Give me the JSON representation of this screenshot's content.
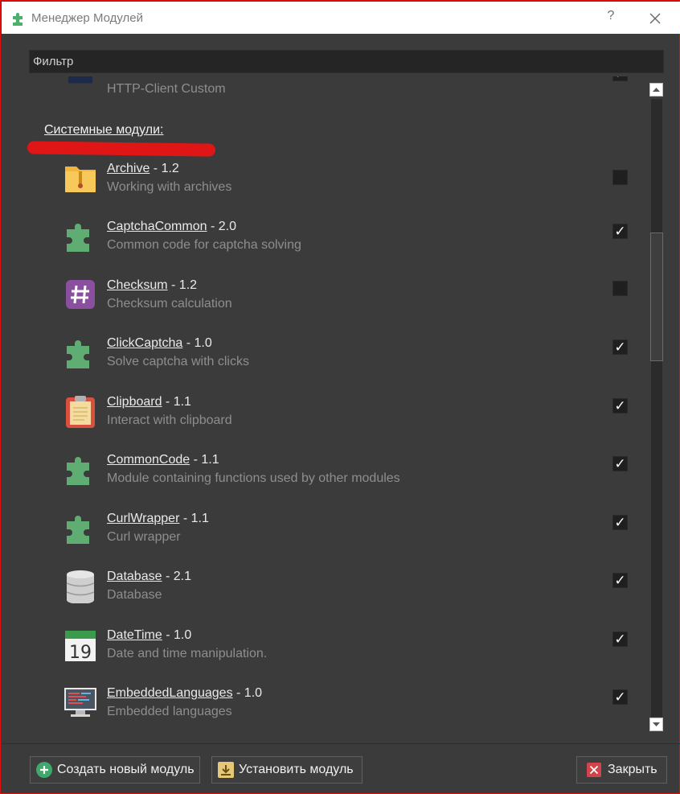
{
  "window": {
    "title": "Менеджер Модулей",
    "help_glyph": "?",
    "accent_border": "#e01010"
  },
  "filter": {
    "placeholder": "Фильтр"
  },
  "partial_item": {
    "description": "HTTP-Client Custom",
    "checked": true
  },
  "section": {
    "title": "Системные модули:"
  },
  "modules": [
    {
      "name": "Archive",
      "version": "1.2",
      "description": "Working with archives",
      "checked": false,
      "icon": "zip-folder-icon"
    },
    {
      "name": "CaptchaCommon",
      "version": "2.0",
      "description": "Common code for captcha solving",
      "checked": true,
      "icon": "puzzle-icon"
    },
    {
      "name": "Checksum",
      "version": "1.2",
      "description": "Checksum calculation",
      "checked": false,
      "icon": "hash-icon"
    },
    {
      "name": "ClickCaptcha",
      "version": "1.0",
      "description": "Solve captcha with clicks",
      "checked": true,
      "icon": "puzzle-icon"
    },
    {
      "name": "Clipboard",
      "version": "1.1",
      "description": "Interact with clipboard",
      "checked": true,
      "icon": "clipboard-icon"
    },
    {
      "name": "CommonCode",
      "version": "1.1",
      "description": "Module containing functions used by other modules",
      "checked": true,
      "icon": "puzzle-icon"
    },
    {
      "name": "CurlWrapper",
      "version": "1.1",
      "description": "Curl wrapper",
      "checked": true,
      "icon": "puzzle-icon"
    },
    {
      "name": "Database",
      "version": "2.1",
      "description": "Database",
      "checked": true,
      "icon": "database-icon"
    },
    {
      "name": "DateTime",
      "version": "1.0",
      "description": "Date and time manipulation.",
      "checked": true,
      "icon": "calendar-icon",
      "calendar_day": "19"
    },
    {
      "name": "EmbeddedLanguages",
      "version": "1.0",
      "description": "Embedded languages",
      "checked": true,
      "icon": "code-monitor-icon"
    }
  ],
  "version_sep": " - ",
  "check_glyph": "✓",
  "footer": {
    "create_label": "Создать новый модуль",
    "install_label": "Установить модуль",
    "close_label": "Закрыть"
  }
}
